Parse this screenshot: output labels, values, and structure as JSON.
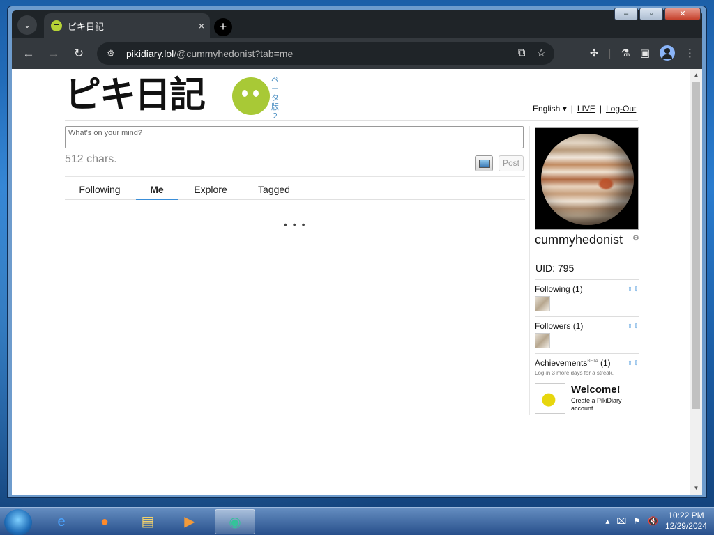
{
  "browser": {
    "tab_title": "ピキ日記",
    "url_host": "pikidiary.lol",
    "url_path": "/@cummyhedonist?tab=me",
    "new_tab_symbol": "+",
    "close_tab_symbol": "×"
  },
  "header": {
    "logo_text": "ピキ日記",
    "beta_text": "ベータ版２",
    "language": "English ▾",
    "live_link": "LIVE",
    "logout_link": "Log-Out"
  },
  "compose": {
    "placeholder": "What's on your mind?",
    "chars_left": "512 chars.",
    "post_label": "Post"
  },
  "tabs": [
    "Following",
    "Me",
    "Explore",
    "Tagged"
  ],
  "active_tab": "Me",
  "loading_text": "• • •",
  "profile": {
    "username": "cummyhedonist",
    "uid": "UID: 795",
    "following_label": "Following",
    "following_count": "(1)",
    "followers_label": "Followers",
    "followers_count": "(1)",
    "achievements_label": "Achievements",
    "achievements_beta": "BETA",
    "achievements_count": "(1)",
    "streak_text": "Log-in 3 more days for a streak.",
    "achievement_title": "Welcome!",
    "achievement_desc": "Create a PikiDiary account",
    "sort_arrows": "⇧⇩"
  },
  "taskbar": {
    "time": "10:22 PM",
    "date": "12/29/2024"
  },
  "colors": {
    "accent": "#3a8ed8",
    "logo_green": "#a8c936",
    "browser_dark": "#34393e"
  }
}
